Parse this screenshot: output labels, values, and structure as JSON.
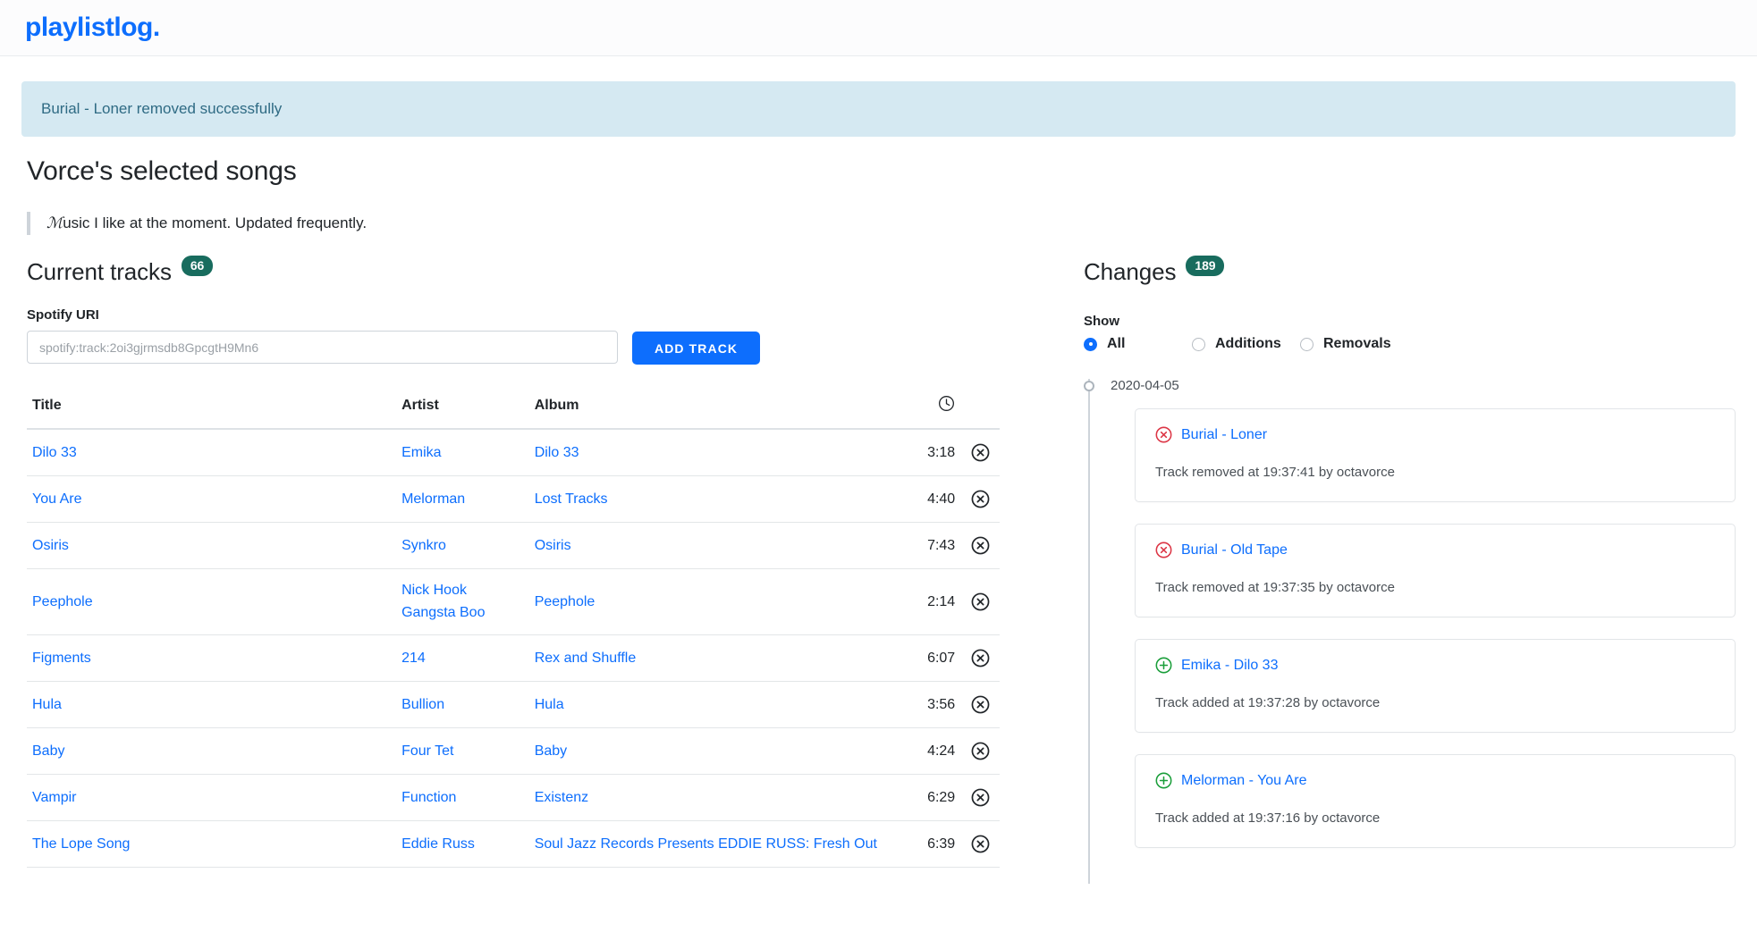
{
  "brand": {
    "name": "playlistlog."
  },
  "alert": {
    "message": "Burial - Loner removed successfully"
  },
  "page": {
    "title": "Vorce's selected songs",
    "description_initial": "ℳ",
    "description_rest": "usic I like at the moment. Updated frequently."
  },
  "tracks_panel": {
    "heading": "Current tracks",
    "count": "66",
    "form": {
      "label": "Spotify URI",
      "value": "",
      "placeholder": "spotify:track:2oi3gjrmsdb8GpcgtH9Mn6",
      "submit_label": "ADD TRACK"
    },
    "columns": {
      "title": "Title",
      "artist": "Artist",
      "album": "Album",
      "duration_icon": "clock-icon",
      "actions": ""
    },
    "rows": [
      {
        "title": "Dilo 33",
        "artists": [
          "Emika"
        ],
        "album": "Dilo 33",
        "duration": "3:18"
      },
      {
        "title": "You Are",
        "artists": [
          "Melorman"
        ],
        "album": "Lost Tracks",
        "duration": "4:40"
      },
      {
        "title": "Osiris",
        "artists": [
          "Synkro"
        ],
        "album": "Osiris",
        "duration": "7:43"
      },
      {
        "title": "Peephole",
        "artists": [
          "Nick Hook",
          "Gangsta Boo"
        ],
        "album": "Peephole",
        "duration": "2:14"
      },
      {
        "title": "Figments",
        "artists": [
          "214"
        ],
        "album": "Rex and Shuffle",
        "duration": "6:07"
      },
      {
        "title": "Hula",
        "artists": [
          "Bullion"
        ],
        "album": "Hula",
        "duration": "3:56"
      },
      {
        "title": "Baby",
        "artists": [
          "Four Tet"
        ],
        "album": "Baby",
        "duration": "4:24"
      },
      {
        "title": "Vampir",
        "artists": [
          "Function"
        ],
        "album": "Existenz",
        "duration": "6:29"
      },
      {
        "title": "The Lope Song",
        "artists": [
          "Eddie Russ"
        ],
        "album": "Soul Jazz Records Presents EDDIE RUSS: Fresh Out",
        "duration": "6:39"
      }
    ]
  },
  "changes_panel": {
    "heading": "Changes",
    "count": "189",
    "filter": {
      "label": "Show",
      "options": [
        {
          "label": "All",
          "selected": true
        },
        {
          "label": "Additions",
          "selected": false
        },
        {
          "label": "Removals",
          "selected": false
        }
      ]
    },
    "timeline": [
      {
        "date": "2020-04-05",
        "entries": [
          {
            "type": "removal",
            "title": "Burial - Loner",
            "detail": "Track removed at 19:37:41 by octavorce"
          },
          {
            "type": "removal",
            "title": "Burial - Old Tape",
            "detail": "Track removed at 19:37:35 by octavorce"
          },
          {
            "type": "addition",
            "title": "Emika - Dilo 33",
            "detail": "Track added at 19:37:28 by octavorce"
          },
          {
            "type": "addition",
            "title": "Melorman - You Are",
            "detail": "Track added at 19:37:16 by octavorce"
          }
        ]
      }
    ]
  },
  "colors": {
    "brand_blue": "#0d6efd",
    "badge_teal": "#186c5e",
    "alert_bg": "#d5e9f2",
    "alert_text": "#2f6b84",
    "removal_red": "#dc3545",
    "addition_green": "#1a9e3a",
    "link_blue": "#0d6efd"
  }
}
